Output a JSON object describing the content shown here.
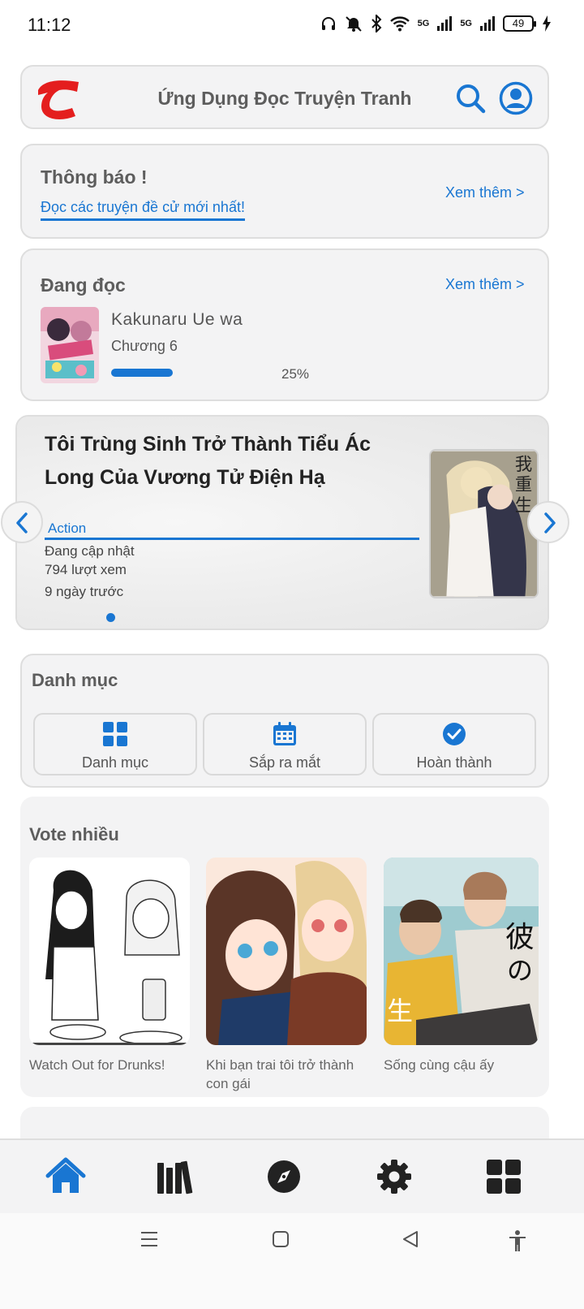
{
  "status_bar": {
    "time": "11:12",
    "battery": "49",
    "signal_1": "5G",
    "signal_2": "5G"
  },
  "header": {
    "title": "Ứng Dụng Đọc Truyện Tranh"
  },
  "notify": {
    "title": "Thông báo !",
    "link": "Đọc các truyện đề cử mới nhất!",
    "see_more": "Xem thêm >"
  },
  "reading": {
    "title": "Đang đọc",
    "see_more": "Xem thêm >",
    "manga_name": "Kakunaru Ue wa",
    "chapter": "Chương 6",
    "progress_text": "25%",
    "progress": 0.25
  },
  "featured": {
    "title": "Tôi Trùng Sinh Trở Thành Tiểu Ác Long Của Vương Tử Điện Hạ",
    "genre": "Action",
    "status": "Đang cập nhật",
    "views": "794 lượt xem",
    "updated": "9 ngày trước"
  },
  "category": {
    "title": "Danh mục",
    "buttons": [
      {
        "label": "Danh mục",
        "icon": "grid-icon"
      },
      {
        "label": "Sắp ra mắt",
        "icon": "calendar-icon"
      },
      {
        "label": "Hoàn thành",
        "icon": "check-circle-icon"
      }
    ]
  },
  "vote": {
    "title": "Vote nhiều",
    "items": [
      {
        "name": "Watch Out for Drunks!"
      },
      {
        "name": "Khi bạn trai tôi trở thành con gái"
      },
      {
        "name": "Sống cùng cậu ấy"
      }
    ]
  },
  "bottom_nav": [
    "home-icon",
    "library-icon",
    "explore-icon",
    "settings-icon",
    "apps-icon"
  ],
  "colors": {
    "accent": "#1976d2",
    "card_bg": "#f3f3f4",
    "logo_red": "#e41e1e"
  }
}
